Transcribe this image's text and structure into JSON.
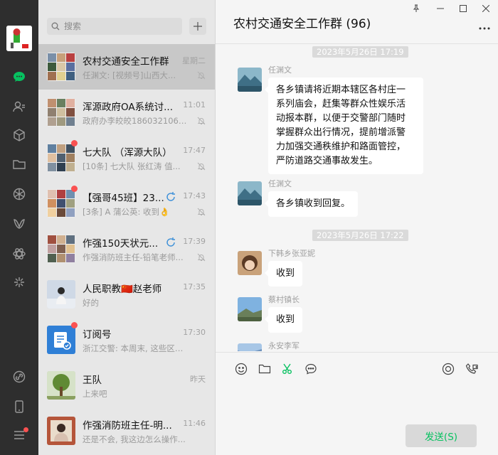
{
  "search": {
    "placeholder": "搜索"
  },
  "chat_list": [
    {
      "name": "农村交通安全工作群",
      "time": "星期二",
      "preview": "任渊文: [视频号]山西大...",
      "muted": true,
      "unread": false,
      "active": true
    },
    {
      "name": "浑源政府OA系统讨...",
      "time": "11:01",
      "preview": "政府办李皎皎18603210695...",
      "muted": true,
      "unread": false
    },
    {
      "name": "七大队 （浑源大队）",
      "time": "17:47",
      "preview": "[10条] 七大队 张红涛 值...",
      "muted": true,
      "unread": true
    },
    {
      "name": "【强哥45班】23...",
      "time": "17:43",
      "preview": "[3条] A 蒲公英: 收到👌",
      "muted": true,
      "unread": true
    },
    {
      "name": "作强150天状元...",
      "time": "17:39",
      "preview": "作强消防班主任-铅笔老师...",
      "muted": true,
      "unread": false
    },
    {
      "name": "人民职教🇨🇳赵老师",
      "time": "17:35",
      "preview": "好的",
      "muted": false,
      "unread": false
    },
    {
      "name": "订阅号",
      "time": "17:30",
      "preview": "浙江交警: 本周末, 这些区域...",
      "muted": false,
      "unread": true
    },
    {
      "name": "王队",
      "time": "昨天",
      "preview": "上来吧",
      "muted": false,
      "unread": false
    },
    {
      "name": "作强消防班主任-明...",
      "time": "11:46",
      "preview": "还是不会, 我这边怎么操作...",
      "muted": false,
      "unread": false
    }
  ],
  "chat": {
    "title": "农村交通安全工作群 (96)",
    "messages": [
      {
        "type": "stamp",
        "text": "2023年5月26日 17:19"
      },
      {
        "type": "msg",
        "sender": "任渊文",
        "lines": [
          "各乡镇请将近期本辖区各村庄一",
          "系列庙会，赶集等群众性娱乐活",
          "动报本群，以便于交警部门随时",
          "掌握群众出行情况，提前增派警",
          "力加强交通秩维护和路面管控，",
          "严防道路交通事故发生。"
        ]
      },
      {
        "type": "msg",
        "sender": "任渊文",
        "lines": [
          "各乡镇收到回复。"
        ]
      },
      {
        "type": "stamp",
        "text": "2023年5月26日 17:22"
      },
      {
        "type": "msg",
        "sender": "下韩乡张亚妮",
        "lines": [
          "收到"
        ]
      },
      {
        "type": "msg",
        "sender": "蔡村镇长",
        "lines": [
          "收到"
        ]
      },
      {
        "type": "msg",
        "sender": "永安李军",
        "lines": []
      }
    ]
  },
  "send_button": "发送(S)",
  "colors": {
    "rail": "#2e2e2e",
    "list": "#e7e7e7",
    "active_item": "#c8c8c8",
    "accent": "#07c160",
    "badge": "#fa5151"
  }
}
